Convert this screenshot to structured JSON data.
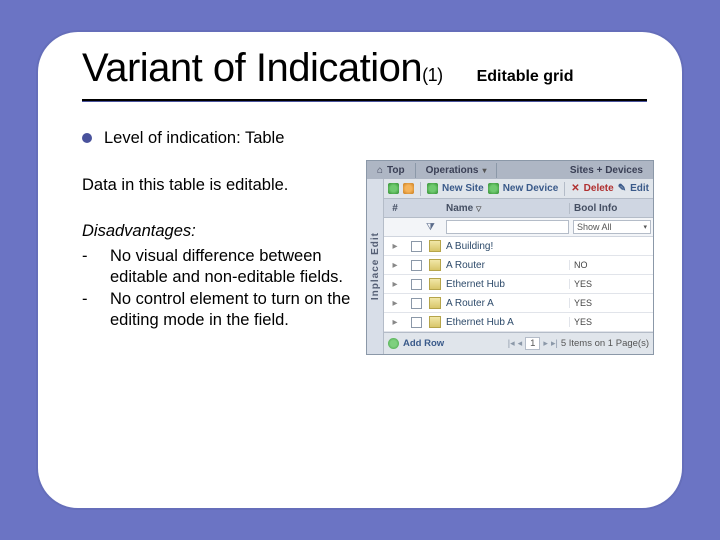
{
  "slide": {
    "title_main": "Variant of Indication",
    "title_suffix": "(1)",
    "title_tag": "Editable grid",
    "bullet": "Level of indication: Table",
    "intro": "Data in this table is editable.",
    "dis_heading": "Disadvantages:",
    "dis_items": [
      "No visual difference between editable and non-editable fields.",
      "No control element to turn on the editing mode in the field."
    ]
  },
  "shot": {
    "topbar": {
      "left": "Top",
      "mid": "Operations",
      "right": "Sites + Devices"
    },
    "side_label": "Inplace Edit",
    "toolbar": {
      "new_site": "New Site",
      "new_device": "New Device",
      "delete": "Delete",
      "edit": "Edit"
    },
    "columns": {
      "hash": "#",
      "name": "Name",
      "bool": "Bool Info"
    },
    "filter": {
      "name_ph": "",
      "bool_label": "Show All"
    },
    "rows": [
      {
        "name": "A Building!",
        "bool": ""
      },
      {
        "name": "A Router",
        "bool": "NO"
      },
      {
        "name": "Ethernet Hub",
        "bool": "YES"
      },
      {
        "name": "A Router A",
        "bool": "YES"
      },
      {
        "name": "Ethernet Hub A",
        "bool": "YES"
      }
    ],
    "footer": {
      "add_row": "Add Row",
      "page_num": "1",
      "summary": "5 Items on 1 Page(s)"
    }
  }
}
